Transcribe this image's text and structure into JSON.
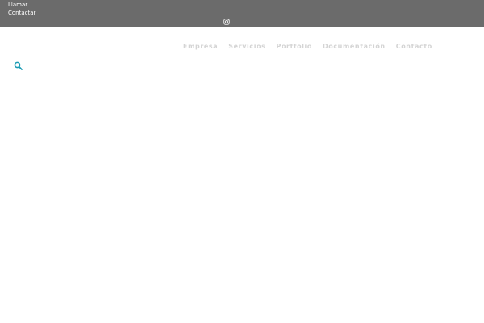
{
  "topbar": {
    "links": [
      "Llamar",
      "Contactar"
    ],
    "social_icon": "instagram-icon",
    "background": "#6b6b6b"
  },
  "nav": {
    "items": [
      "Empresa",
      "Servicios",
      "Portfolio",
      "Documentación",
      "Contacto"
    ],
    "text_color": "#d4d4d4"
  },
  "search": {
    "icon": "search-icon",
    "color": "#1a9bb4"
  }
}
